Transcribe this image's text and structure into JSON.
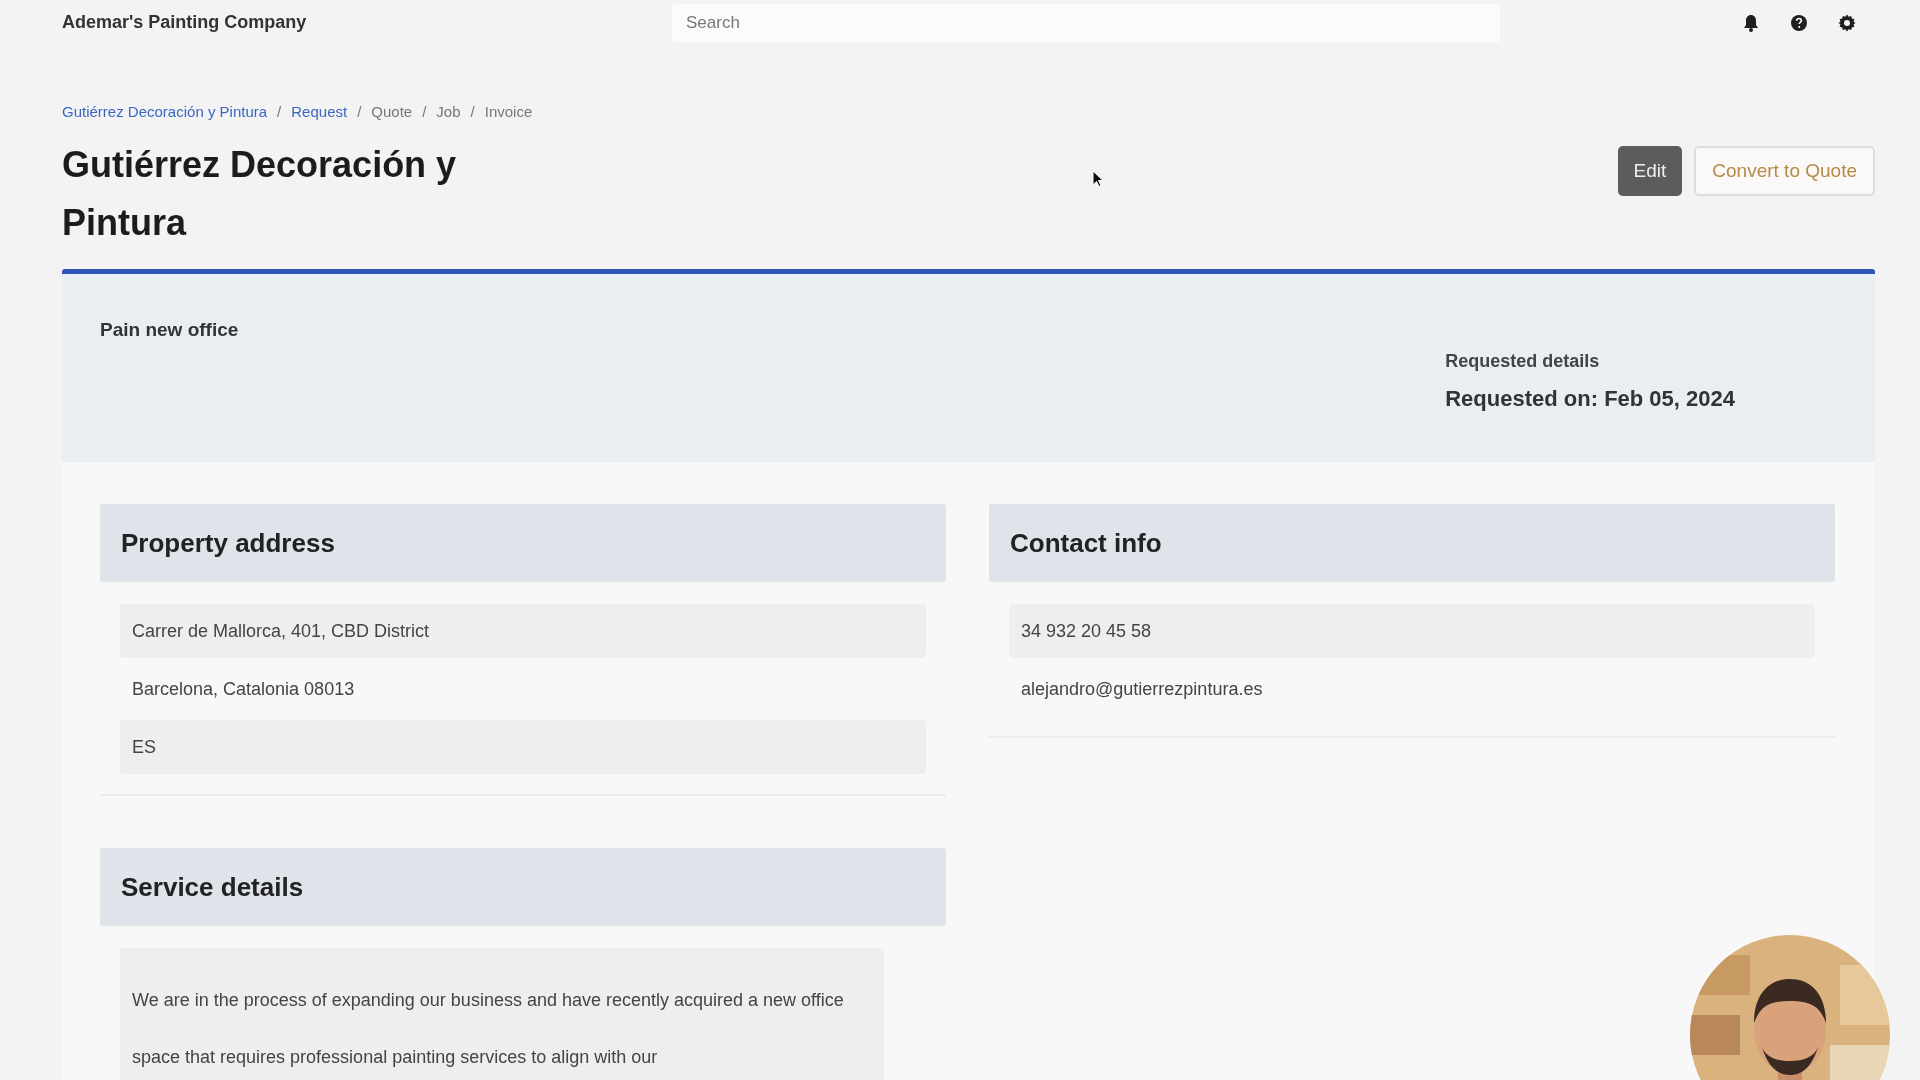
{
  "header": {
    "company": "Ademar's Painting Company",
    "search": {
      "placeholder": "Search"
    }
  },
  "breadcrumb": {
    "separator": "/",
    "items": [
      {
        "label": "Gutiérrez Decoración y Pintura",
        "linked": true
      },
      {
        "label": "Request",
        "linked": true
      },
      {
        "label": "Quote",
        "linked": false
      },
      {
        "label": "Job",
        "linked": false
      },
      {
        "label": "Invoice",
        "linked": false
      }
    ]
  },
  "title": "Gutiérrez Decoración y Pintura",
  "actions": [
    {
      "label": "Edit",
      "kind": "primary"
    },
    {
      "label": "Convert to Quote",
      "kind": "outline"
    }
  ],
  "summary": {
    "request_title": "Pain new office",
    "details_label": "Requested details",
    "requested_on": "Requested on: Feb 05, 2024"
  },
  "sections": [
    {
      "heading": "Property address",
      "rows": [
        "Carrer de Mallorca, 401, CBD District",
        "Barcelona, Catalonia 08013",
        "ES"
      ]
    },
    {
      "heading": "Contact info",
      "rows": [
        "34 932 20 45 58",
        "alejandro@gutierrezpintura.es"
      ]
    },
    {
      "heading": "Service details",
      "paragraph": "We are in the process of expanding our business and have recently acquired a new office space that requires professional painting services to align with our"
    }
  ]
}
